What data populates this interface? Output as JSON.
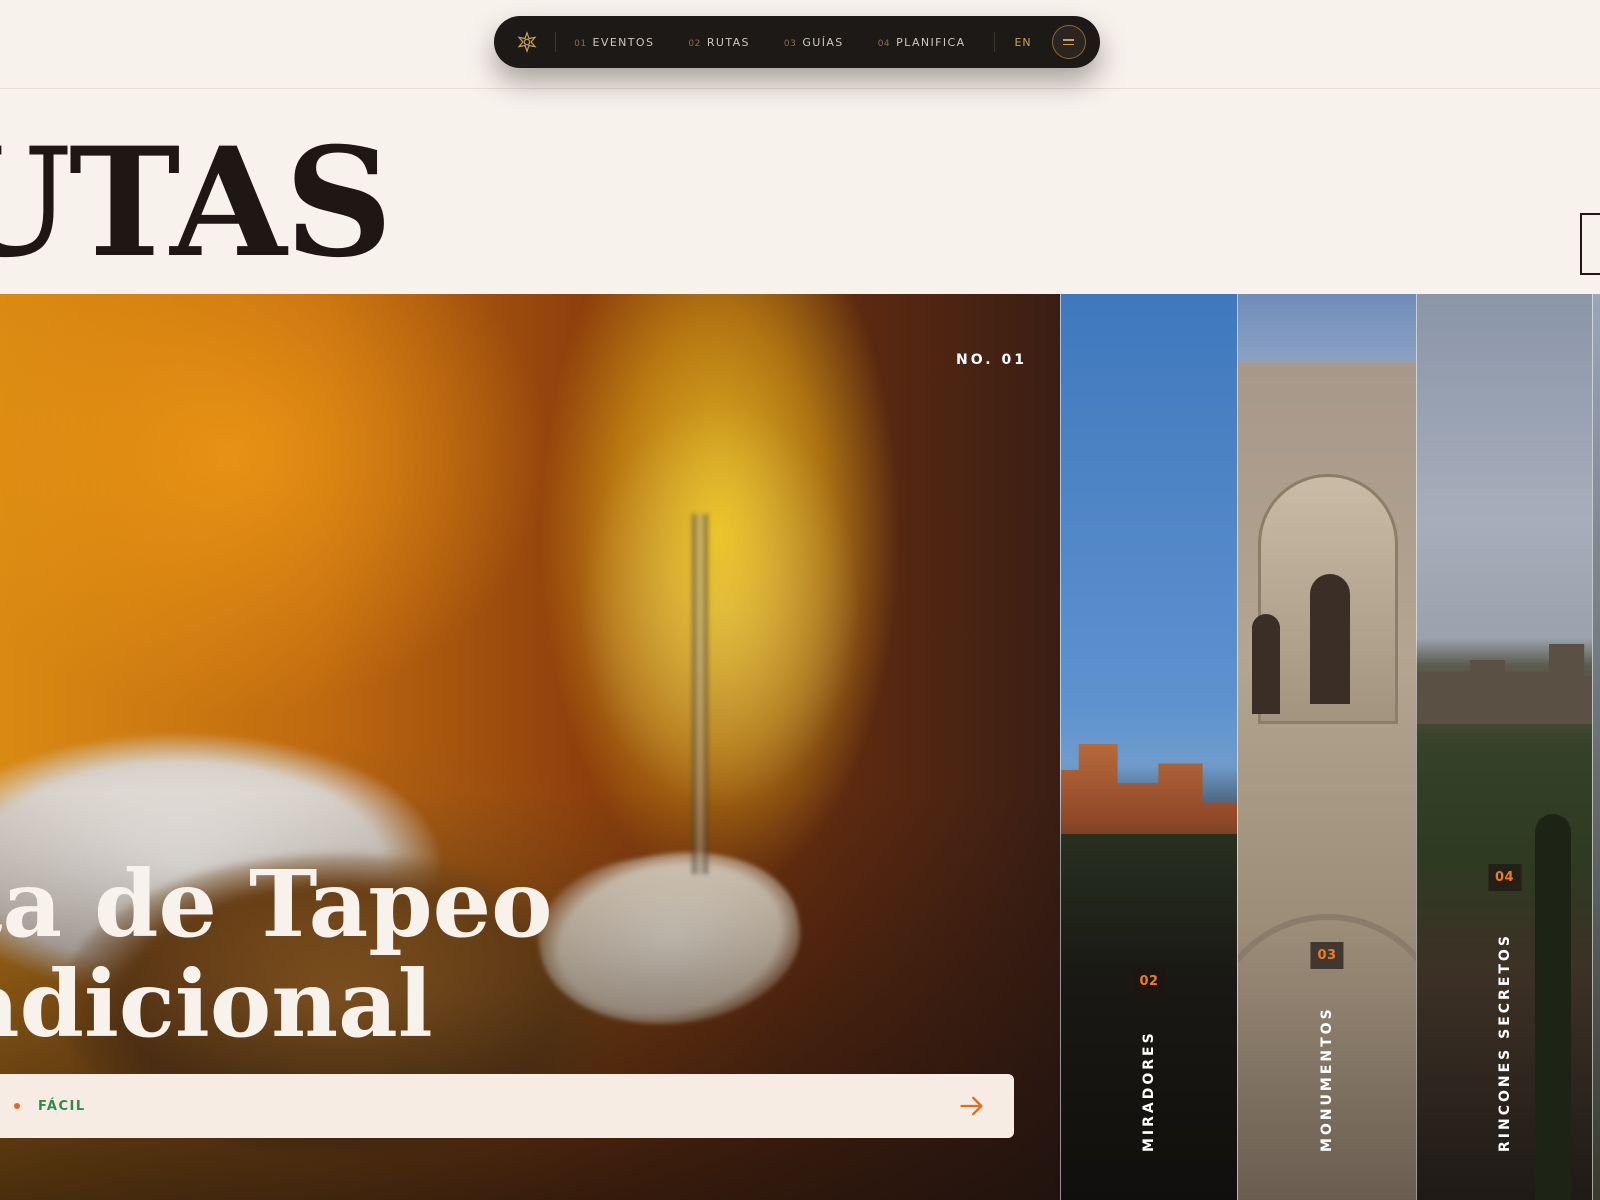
{
  "nav": {
    "items": [
      {
        "num": "01",
        "label": "EVENTOS"
      },
      {
        "num": "02",
        "label": "RUTAS"
      },
      {
        "num": "03",
        "label": "GUÍAS"
      },
      {
        "num": "04",
        "label": "PLANIFICA"
      }
    ],
    "lang": "EN"
  },
  "page": {
    "title": "UTAS"
  },
  "hero": {
    "number": "NO. 01",
    "title_line1": "ta de Tapeo",
    "title_line2": "adicional",
    "difficulty": "FÁCIL"
  },
  "routes": [
    {
      "num": "02",
      "label": "MIRADORES"
    },
    {
      "num": "03",
      "label": "MONUMENTOS"
    },
    {
      "num": "04",
      "label": "RINCONES SECRETOS"
    }
  ],
  "colors": {
    "accent": "#e26b1f",
    "gold": "#c9a25a",
    "nav_bg": "#1c1917",
    "page_bg": "#f8f2ed",
    "difficulty": "#2f8a4a"
  }
}
